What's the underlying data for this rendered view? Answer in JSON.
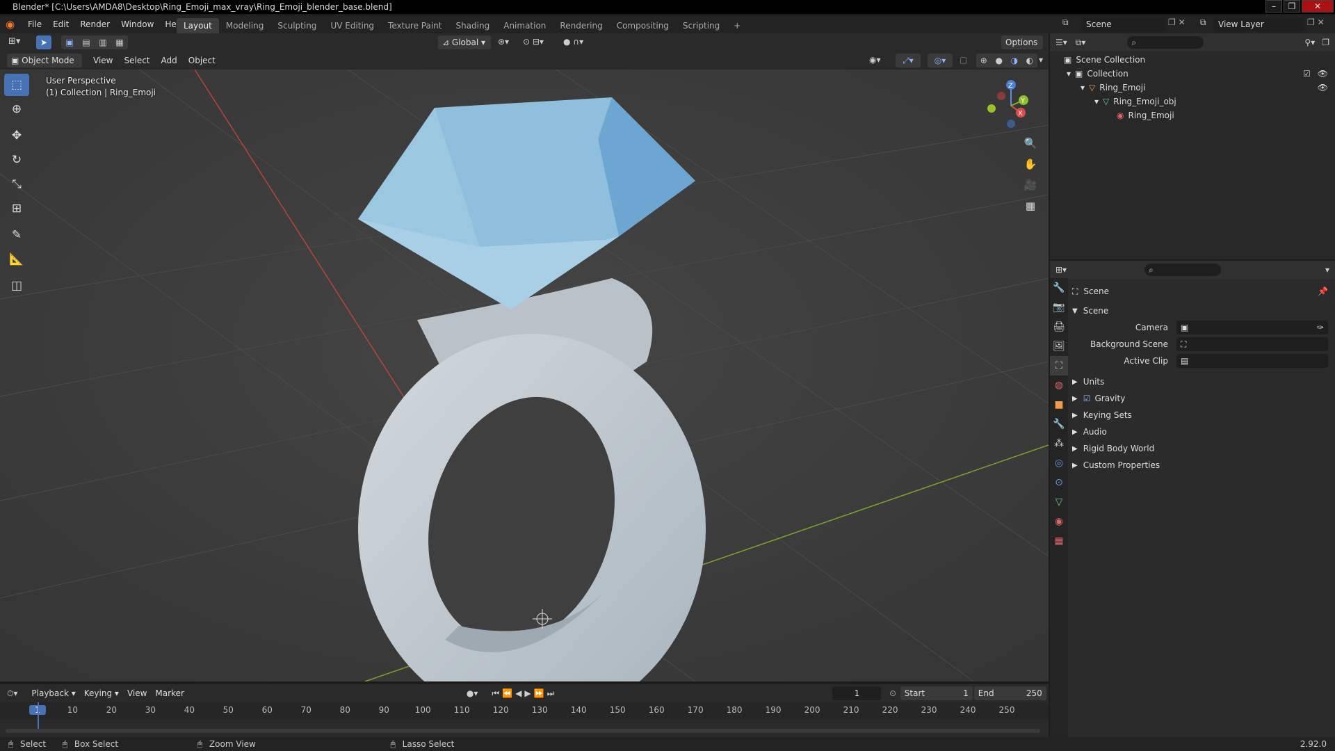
{
  "window": {
    "title": "Blender* [C:\\Users\\AMDA8\\Desktop\\Ring_Emoji_max_vray\\Ring_Emoji_blender_base.blend]"
  },
  "menus": [
    "File",
    "Edit",
    "Render",
    "Window",
    "Help"
  ],
  "workspaces": [
    "Layout",
    "Modeling",
    "Sculpting",
    "UV Editing",
    "Texture Paint",
    "Shading",
    "Animation",
    "Rendering",
    "Compositing",
    "Scripting"
  ],
  "scene": {
    "name": "Scene",
    "view_layer": "View Layer"
  },
  "header": {
    "transform_orientation": "Global",
    "options": "Options"
  },
  "viewport": {
    "mode": "Object Mode",
    "menu": [
      "View",
      "Select",
      "Add",
      "Object"
    ],
    "info_line1": "User Perspective",
    "info_line2": "(1) Collection | Ring_Emoji",
    "gizmo": {
      "x": "X",
      "y": "Y",
      "z": "Z"
    }
  },
  "outliner": {
    "items": [
      {
        "label": "Scene Collection",
        "depth": 0
      },
      {
        "label": "Collection",
        "depth": 1
      },
      {
        "label": "Ring_Emoji",
        "depth": 2
      },
      {
        "label": "Ring_Emoji_obj",
        "depth": 3
      },
      {
        "label": "Ring_Emoji",
        "depth": 4
      }
    ]
  },
  "properties": {
    "context": "Scene",
    "section": "Scene",
    "fields": [
      {
        "label": "Camera"
      },
      {
        "label": "Background Scene"
      },
      {
        "label": "Active Clip"
      }
    ],
    "panels": [
      "Units",
      "Gravity",
      "Keying Sets",
      "Audio",
      "Rigid Body World",
      "Custom Properties"
    ]
  },
  "timeline": {
    "menus": [
      "Playback",
      "Keying",
      "View",
      "Marker"
    ],
    "current_frame": "1",
    "start_label": "Start",
    "start": "1",
    "end_label": "End",
    "end": "250",
    "ticks": [
      "1",
      "10",
      "20",
      "30",
      "40",
      "50",
      "60",
      "70",
      "80",
      "90",
      "100",
      "110",
      "120",
      "130",
      "140",
      "150",
      "160",
      "170",
      "180",
      "190",
      "200",
      "210",
      "220",
      "230",
      "240",
      "250"
    ]
  },
  "statusbar": {
    "select": "Select",
    "box_select": "Box Select",
    "zoom_view": "Zoom View",
    "lasso_select": "Lasso Select",
    "version": "2.92.0"
  },
  "colors": {
    "accent": "#4772b3",
    "gem": "#8fbfdc",
    "ring": "#c3ccd3",
    "x_axis": "#c0392b",
    "y_axis": "#7fa32a"
  }
}
